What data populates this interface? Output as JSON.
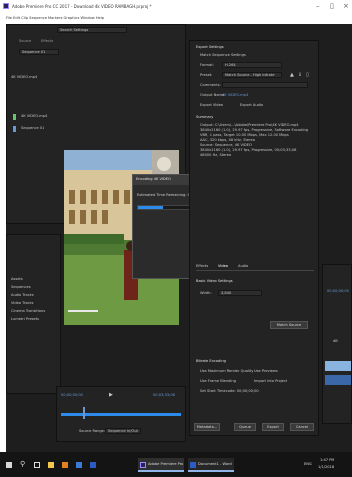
{
  "window": {
    "title": "Adobe Premiere Pro CC 2017 - Download 4k VIDEO RAMBAGH.prproj *",
    "menu": "File Edit Clip Sequence Markers Graphics Window Help"
  },
  "project_panel": {
    "search_label": "Search Settings",
    "tabs": [
      "Source",
      "Effects"
    ],
    "clip_name": "Sequence 01",
    "items": [
      "4K VIDEO.mp4",
      "Sequence 01"
    ],
    "lower_items": [
      "Assets",
      "Sequences",
      "Audio Tracks",
      "Video Tracks",
      "Cinema Transitions",
      "Lumetri Presets"
    ]
  },
  "export_settings": {
    "section_title": "Export Settings",
    "match_sequence_label": "Match Sequence Settings",
    "format_label": "Format:",
    "format_value": "H.264",
    "preset_label": "Preset:",
    "preset_value": "Match Source - High bitrate",
    "comments_label": "Comments:",
    "output_name_label": "Output Name:",
    "output_name_value": "4K VIDEO.mp4",
    "export_video_label": "Export Video",
    "export_audio_label": "Export Audio",
    "summary_title": "Summary",
    "summary_lines": [
      "Output: C:\\Users\\...\\Adobe\\Premiere Pro\\4K VIDEO.mp4",
      "3840x2160 (1.0), 29.97 fps, Progressive, Software Encoding",
      "VBR, 1 pass, Target 10.00 Mbps, Max 12.00 Mbps",
      "AAC, 320 kbps, 48 kHz, Stereo",
      "",
      "Source: Sequence, 4K VIDEO",
      "3840x2160 (1.0), 29.97 fps, Progressive, 00;03;33;08",
      "48000 Hz, Stereo"
    ],
    "tabs": [
      "Effects",
      "Video",
      "Audio",
      "Multiplexer",
      "Captions"
    ],
    "basic_video_title": "Basic Video Settings",
    "width_label": "Width:",
    "width_value": "3,840",
    "match_source_button": "Match Source",
    "bitrate_title": "Bitrate Encoding",
    "bitrate_options": [
      "Use Maximum Render Quality",
      "Use Previews",
      "Use Frame Blending",
      "Import into Project"
    ],
    "bitrate_value": "Set Start Timecode: 00;00;00;00",
    "metadata_button": "Metadata...",
    "queue_button": "Queue",
    "export_button": "Export",
    "cancel_button": "Cancel"
  },
  "encoding_dialog": {
    "title": "Encoding 4K VIDEO",
    "message": "Estimated Time Remaining: 0 Minutes, 37 Seconds",
    "progress": 0.36,
    "percent": "36%",
    "cancel_label": "Cancel"
  },
  "timeline": {
    "timecode_left": "00;00;00;00",
    "timecode_right": "00;03;33;08",
    "playhead": 0.18,
    "source_range_label": "Source Range:",
    "source_range_value": "Sequence In/Out",
    "fit_label": "Fit"
  },
  "right_edge": {
    "timecode": "00;00;00;00",
    "meter_label": "dB"
  },
  "taskbar": {
    "search_placeholder": "",
    "apps": [
      "Adobe Premiere Pro",
      "Document1 - Word"
    ],
    "tray_text": "ENG",
    "clock_time": "1:47 PM",
    "clock_date": "1/1/2018"
  },
  "colors": {
    "app_bg": "#1e1e1e",
    "panel_bg": "#232323",
    "accent_blue": "#2d8ceb",
    "progress_blue": "#2d8ceb",
    "highlight": "#6b98d2"
  }
}
